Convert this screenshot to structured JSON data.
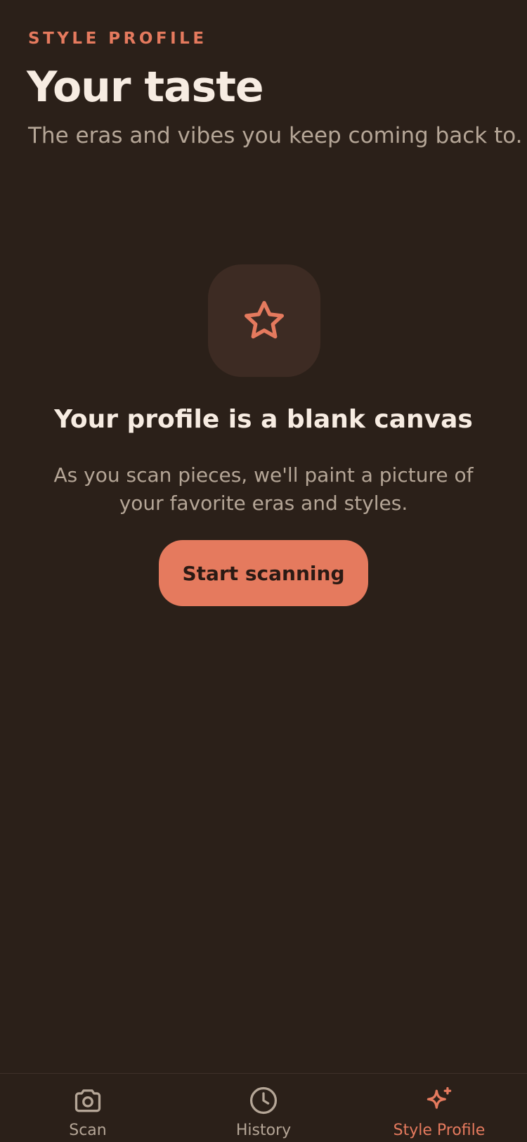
{
  "header": {
    "eyebrow": "STYLE PROFILE",
    "title": "Your taste",
    "subtitle": "The eras and vibes you keep coming back to."
  },
  "empty_state": {
    "icon": "star-icon",
    "title": "Your profile is a blank canvas",
    "body": "As you scan pieces, we'll paint a picture of your favorite eras and styles.",
    "cta_label": "Start scanning"
  },
  "tabbar": {
    "active": "Style Profile",
    "items": [
      {
        "label": "Scan",
        "icon": "camera-icon"
      },
      {
        "label": "History",
        "icon": "clock-icon"
      },
      {
        "label": "Style Profile",
        "icon": "sparkles-icon"
      }
    ]
  },
  "colors": {
    "background": "#2b2019",
    "accent": "#e57a5e",
    "primary_text": "#f7ece2",
    "secondary_text": "#b5a697",
    "icon_tile": "#3d2b23"
  }
}
